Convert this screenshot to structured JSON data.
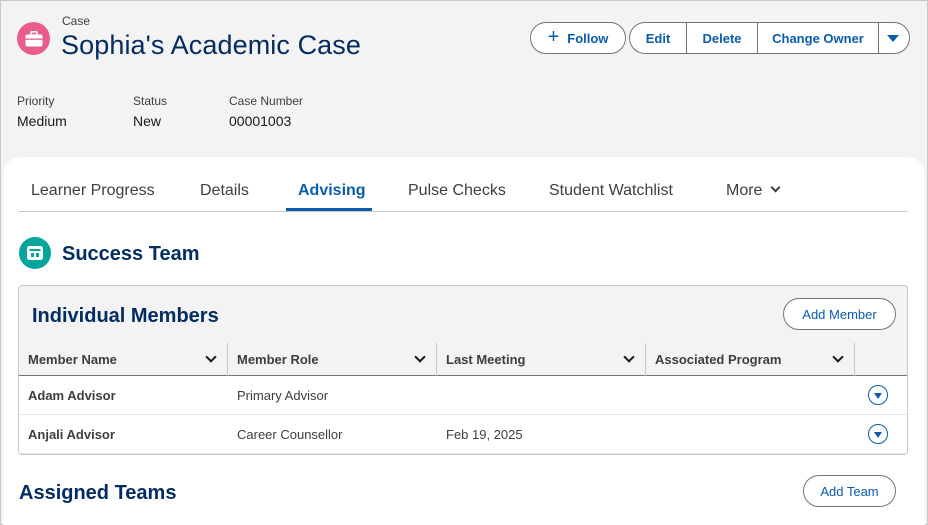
{
  "header": {
    "object_label": "Case",
    "title": "Sophia's Academic Case",
    "icon": "briefcase-icon",
    "actions": {
      "follow": "Follow",
      "edit": "Edit",
      "delete": "Delete",
      "change_owner": "Change Owner"
    },
    "fields": [
      {
        "label": "Priority",
        "value": "Medium"
      },
      {
        "label": "Status",
        "value": "New"
      },
      {
        "label": "Case Number",
        "value": "00001003"
      }
    ]
  },
  "tabs": [
    {
      "label": "Learner Progress",
      "active": false
    },
    {
      "label": "Details",
      "active": false
    },
    {
      "label": "Advising",
      "active": true
    },
    {
      "label": "Pulse Checks",
      "active": false
    },
    {
      "label": "Student Watchlist",
      "active": false
    },
    {
      "label": "More",
      "active": false
    }
  ],
  "success_team": {
    "title": "Success Team",
    "icon": "team-icon",
    "individual_members": {
      "title": "Individual Members",
      "add_button": "Add Member",
      "columns": [
        "Member Name",
        "Member Role",
        "Last Meeting",
        "Associated Program"
      ],
      "rows": [
        {
          "name": "Adam Advisor",
          "role": "Primary Advisor",
          "last_meeting": "",
          "program": ""
        },
        {
          "name": "Anjali Advisor",
          "role": "Career Counsellor",
          "last_meeting": "Feb 19, 2025",
          "program": ""
        }
      ]
    }
  },
  "assigned_teams": {
    "title": "Assigned Teams",
    "add_button": "Add Team"
  },
  "colors": {
    "brand_blue": "#0b5cab",
    "title_navy": "#032d60",
    "case_icon_pink": "#e95c8e",
    "team_icon_teal": "#06a59a"
  }
}
